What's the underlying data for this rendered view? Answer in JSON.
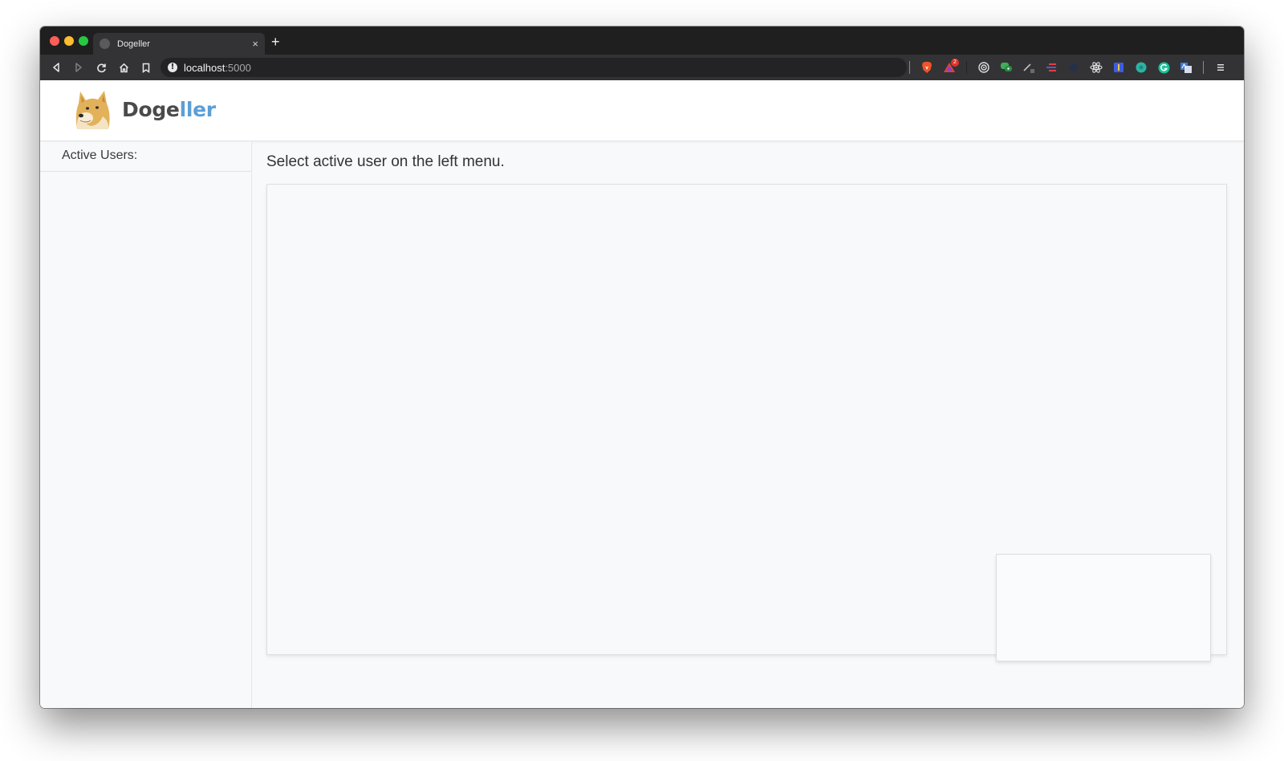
{
  "browser": {
    "tab_title": "Dogeller",
    "tab_close": "×",
    "new_tab": "+",
    "url_host": "localhost",
    "url_port": ":5000",
    "info_glyph": "!",
    "extension_badge": "2",
    "icons": [
      "back-icon",
      "forward-icon",
      "reload-icon",
      "home-icon",
      "bookmark-icon",
      "info-icon",
      "brave-shield-icon",
      "brave-rewards-icon",
      "target-extension-icon",
      "chat-extension-icon",
      "pen-extension-icon",
      "list-extension-icon",
      "dark-extension-icon",
      "react-devtools-icon",
      "blue-extension-icon",
      "teal-extension-icon",
      "grammarly-icon",
      "translate-icon",
      "menu-icon"
    ]
  },
  "app": {
    "brand_primary": "Doge",
    "brand_secondary": "ller",
    "brand_colors": {
      "primary": "#4a4a4a",
      "secondary": "#5b9fd6"
    }
  },
  "sidebar": {
    "title": "Active Users:",
    "users": []
  },
  "main": {
    "heading": "Select active user on the left menu."
  }
}
